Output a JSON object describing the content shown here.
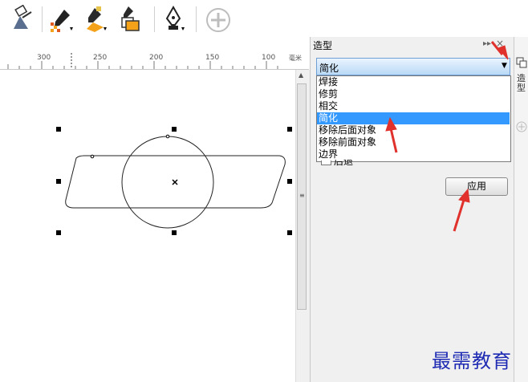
{
  "toolbar": {
    "tools": [
      {
        "name": "smart-fill-icon"
      },
      {
        "name": "eyedropper-icon"
      },
      {
        "name": "color-fill-icon"
      },
      {
        "name": "attributes-eyedropper-icon"
      },
      {
        "name": "pen-icon"
      },
      {
        "name": "add-icon"
      }
    ]
  },
  "ruler": {
    "labels": [
      "300",
      "250",
      "200",
      "150",
      "100"
    ],
    "unit": "毫米"
  },
  "panel": {
    "title": "造型",
    "pin_glyph": "▸▸",
    "close_glyph": "×",
    "combo_value": "简化",
    "options": [
      "焊接",
      "修剪",
      "相交",
      "简化",
      "移除后面对象",
      "移除前面对象",
      "边界"
    ],
    "selected_option": "简化",
    "hidden_checkbox_label": "后退",
    "apply_label": "应用"
  },
  "tabstrip": {
    "tab_label": "造型"
  },
  "colors": {
    "selection": "#3399ff",
    "annotation_arrow": "#e0312c",
    "watermark": "#1f2bb3"
  },
  "watermark": "最需教育"
}
